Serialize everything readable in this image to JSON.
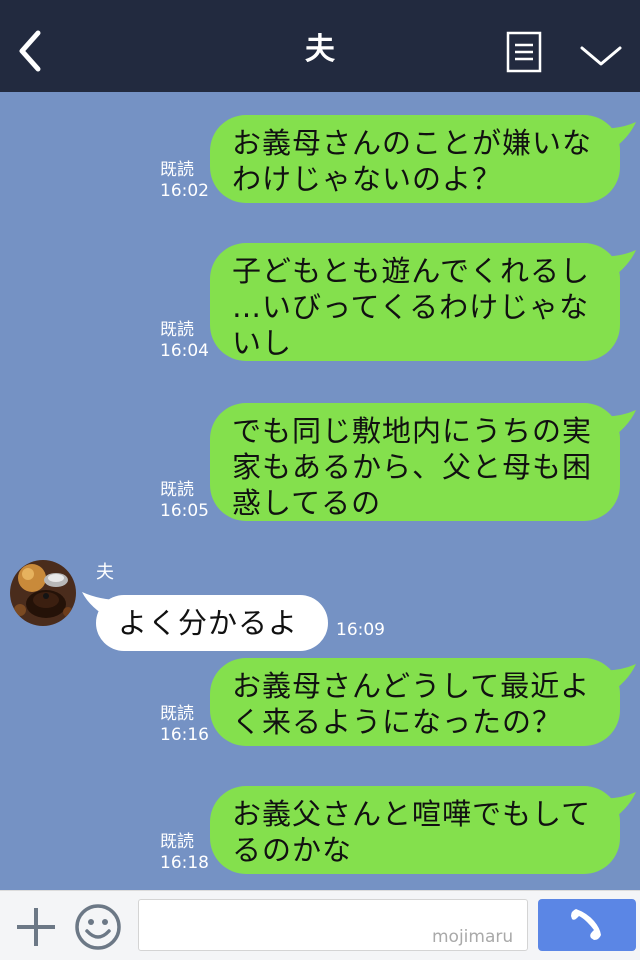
{
  "header": {
    "title": "夫",
    "back_icon": "chevron-left-icon",
    "menu_icon": "document-menu-icon",
    "collapse_icon": "chevron-down-icon",
    "background": "#222a3f"
  },
  "chat": {
    "background": "#7592c4",
    "outgoing_bubble_color": "#84e04d",
    "incoming_bubble_color": "#ffffff",
    "read_label": "既読",
    "messages": [
      {
        "direction": "out",
        "lines": [
          "お義母さんのことが嫌いな",
          "わけじゃないのよ？"
        ],
        "time": "16:02"
      },
      {
        "direction": "out",
        "lines": [
          "子どもとも遊んでくれるし",
          "…いびってくるわけじゃな",
          "いし"
        ],
        "time": "16:04"
      },
      {
        "direction": "out",
        "lines": [
          "でも同じ敷地内にうちの実",
          "家もあるから、父と母も困",
          "惑してるの"
        ],
        "time": "16:05"
      },
      {
        "direction": "in",
        "sender": "夫",
        "lines": [
          "よく分かるよ"
        ],
        "time": "16:09"
      },
      {
        "direction": "out",
        "lines": [
          "お義母さんどうして最近よ",
          "く来るようになったの？"
        ],
        "time": "16:16"
      },
      {
        "direction": "out",
        "lines": [
          "お義父さんと喧嘩でもして",
          "るのかな"
        ],
        "time": "16:18"
      }
    ]
  },
  "input_bar": {
    "add_icon": "plus-icon",
    "emoji_icon": "smiley-icon",
    "message_value": "",
    "watermark": "mojimaru",
    "call_icon": "phone-icon",
    "call_button_color": "#5b86e5"
  }
}
